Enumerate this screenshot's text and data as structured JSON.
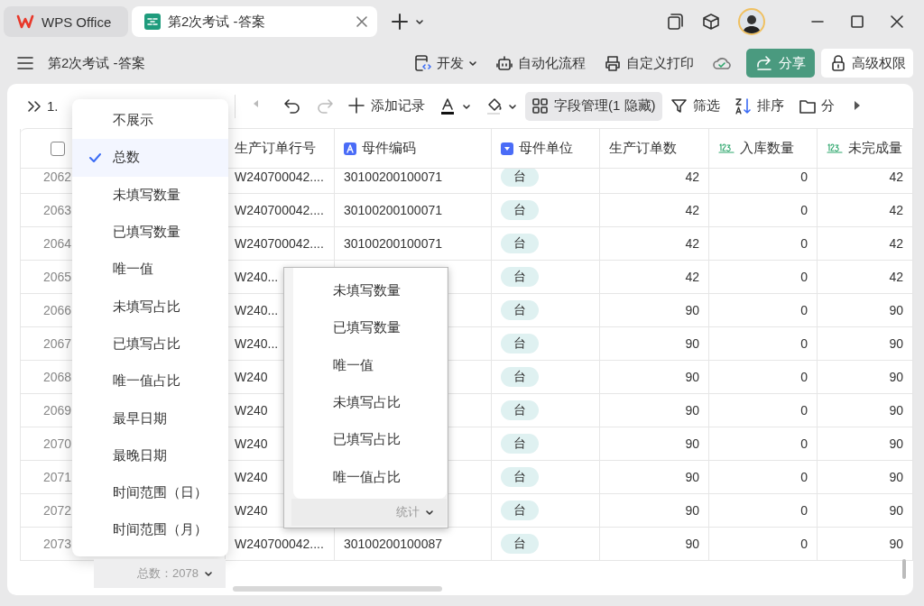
{
  "tabs": [
    {
      "label": "WPS Office",
      "kind": "home",
      "selected": false
    },
    {
      "label": "第2次考试 -答案",
      "kind": "doc",
      "selected": true
    }
  ],
  "doc_title": "第2次考试 -答案",
  "doc_actions": [
    {
      "label": "开发",
      "kind": "dev"
    },
    {
      "label": "自动化流程",
      "kind": "robot"
    },
    {
      "label": "自定义打印",
      "kind": "print"
    }
  ],
  "share_button": "分享",
  "permission_button": "高级权限",
  "view_name": "1.",
  "toolbar": [
    {
      "kind": "prev",
      "disabled": true,
      "selected": false
    },
    {
      "kind": "undo",
      "disabled": false,
      "selected": false
    },
    {
      "kind": "redo",
      "disabled": true,
      "selected": false
    },
    {
      "kind": "add",
      "label": "添加记录",
      "disabled": false,
      "selected": false
    },
    {
      "kind": "text-color",
      "disabled": false,
      "selected": false
    },
    {
      "kind": "fill",
      "disabled": false,
      "selected": false
    },
    {
      "kind": "fields",
      "label": "字段管理(1 隐藏)",
      "disabled": false,
      "selected": true
    },
    {
      "kind": "filter",
      "label": "筛选",
      "disabled": false,
      "selected": false
    },
    {
      "kind": "sort",
      "label": "排序",
      "disabled": false,
      "selected": false
    },
    {
      "kind": "group",
      "label": "分",
      "disabled": false,
      "selected": false
    },
    {
      "kind": "more",
      "disabled": false,
      "selected": false
    }
  ],
  "table": {
    "select_all_checked": false,
    "columns": [
      {
        "label": "生产订单行号",
        "kind": "plain"
      },
      {
        "label": "母件编码",
        "kind": "text"
      },
      {
        "label": "母件单位",
        "kind": "select"
      },
      {
        "label": "生产订单数",
        "kind": "plain"
      },
      {
        "label": "入库数量",
        "kind": "number"
      },
      {
        "label": "未完成量",
        "kind": "number"
      }
    ],
    "rows": [
      {
        "number": "2062",
        "cells": [
          "W240700042....",
          "30100200100071",
          "台",
          "42",
          "0",
          "42"
        ]
      },
      {
        "number": "2063",
        "cells": [
          "W240700042....",
          "30100200100071",
          "台",
          "42",
          "0",
          "42"
        ]
      },
      {
        "number": "2064",
        "cells": [
          "W240700042....",
          "30100200100071",
          "台",
          "42",
          "0",
          "42"
        ]
      },
      {
        "number": "2065",
        "cells": [
          "W240...",
          null,
          "台",
          "42",
          "0",
          "42"
        ]
      },
      {
        "number": "2066",
        "cells": [
          "W240...",
          null,
          "台",
          "90",
          "0",
          "90"
        ]
      },
      {
        "number": "2067",
        "cells": [
          "W240...",
          null,
          "台",
          "90",
          "0",
          "90"
        ]
      },
      {
        "number": "2068",
        "cells": [
          "W240",
          null,
          "台",
          "90",
          "0",
          "90"
        ]
      },
      {
        "number": "2069",
        "cells": [
          "W240",
          null,
          "台",
          "90",
          "0",
          "90"
        ]
      },
      {
        "number": "2070",
        "cells": [
          "W240",
          null,
          "台",
          "90",
          "0",
          "90"
        ]
      },
      {
        "number": "2071",
        "cells": [
          "W240",
          null,
          "台",
          "90",
          "0",
          "90"
        ]
      },
      {
        "number": "2072",
        "cells": [
          "W240",
          null,
          "台",
          "90",
          "0",
          "90"
        ]
      },
      {
        "number": "2073",
        "cells": [
          "W240700042....",
          "30100200100087",
          "台",
          "90",
          "0",
          "90"
        ]
      }
    ]
  },
  "summary_menu": {
    "options": [
      {
        "label": "不展示",
        "selected": false
      },
      {
        "label": "总数",
        "selected": true
      },
      {
        "label": "未填写数量",
        "selected": false
      },
      {
        "label": "已填写数量",
        "selected": false
      },
      {
        "label": "唯一值",
        "selected": false
      },
      {
        "label": "未填写占比",
        "selected": false
      },
      {
        "label": "已填写占比",
        "selected": false
      },
      {
        "label": "唯一值占比",
        "selected": false
      },
      {
        "label": "最早日期",
        "selected": false
      },
      {
        "label": "最晚日期",
        "selected": false
      },
      {
        "label": "时间范围（日）",
        "selected": false
      },
      {
        "label": "时间范围（月）",
        "selected": false
      }
    ],
    "footer": "总数：2078"
  },
  "stats_popup": {
    "options": [
      "未填写数量",
      "已填写数量",
      "唯一值",
      "未填写占比",
      "已填写占比",
      "唯一值占比"
    ],
    "footer": "统计"
  }
}
